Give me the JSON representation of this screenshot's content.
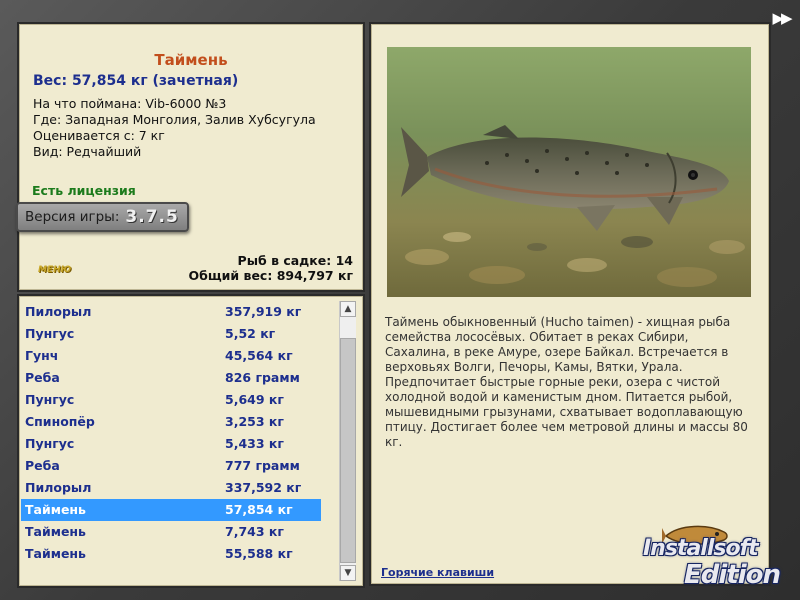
{
  "header": {
    "next_icon": "fast-forward-icon",
    "next_glyph": "▶▶"
  },
  "fish": {
    "name": "Таймень",
    "weight": "Вес: 57,854 кг (зачетная)",
    "caught_on": "На что поймана: Vib-6000 №3",
    "where": "Где: Западная Монголия, Залив Хубсугула",
    "valued_from": "Оценивается с: 7 кг",
    "species": "Вид: Редчайший"
  },
  "license": "Есть лицензия",
  "version": {
    "label": "Версия игры:",
    "number": "3.7.5"
  },
  "menu_logo": "МЕНЮ",
  "keep": {
    "count": "Рыб в садке: 14",
    "total": "Общий вес: 894,797 кг"
  },
  "catch_list": [
    {
      "name": "Пилорыл",
      "weight": "357,919 кг"
    },
    {
      "name": "Пунгус",
      "weight": "5,52 кг"
    },
    {
      "name": "Гунч",
      "weight": "45,564 кг"
    },
    {
      "name": "Реба",
      "weight": "826 грамм"
    },
    {
      "name": "Пунгус",
      "weight": "5,649 кг"
    },
    {
      "name": "Спинопёр",
      "weight": "3,253 кг"
    },
    {
      "name": "Пунгус",
      "weight": "5,433 кг"
    },
    {
      "name": "Реба",
      "weight": "777 грамм"
    },
    {
      "name": "Пилорыл",
      "weight": "337,592 кг"
    },
    {
      "name": "Таймень",
      "weight": "57,854 кг"
    },
    {
      "name": "Таймень",
      "weight": "7,743 кг"
    },
    {
      "name": "Таймень",
      "weight": "55,588 кг"
    }
  ],
  "selected_index": 9,
  "description": "Таймень обыкновенный (Hucho taimen) - хищная рыба семейства лососёвых. Обитает в реках Сибири, Сахалина, в реке Амуре, озере Байкал. Встречается в верховьях Волги, Печоры, Камы, Вятки, Урала. Предпочитает быстрые горные реки, озера с чистой холодной водой и каменистым дном. Питается рыбой, мышевидными грызунами, схватывает водоплавающую птицу. Достигает более чем метровой длины и массы 80 кг.",
  "hotkeys": "Горячие клавиши",
  "watermark": {
    "line1": "Installsoft",
    "line2": "Edition"
  },
  "colors": {
    "panel_bg": "#f0ebd0",
    "fish_name": "#c24e1c",
    "weight_text": "#1d2f8e",
    "license_text": "#1c7b1c",
    "selection": "#3399ff"
  }
}
